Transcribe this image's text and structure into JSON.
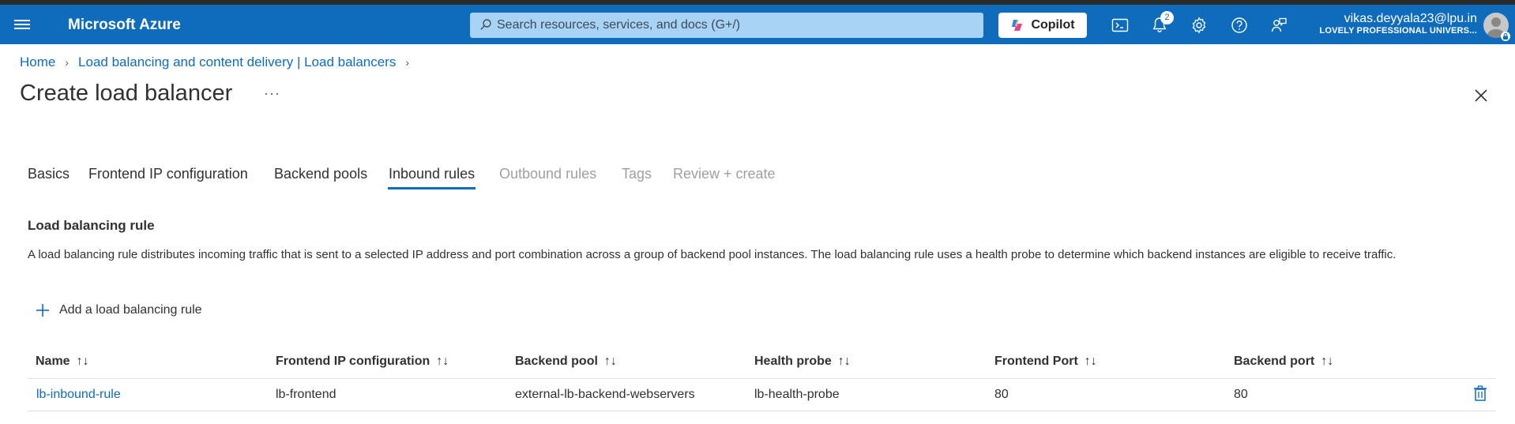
{
  "topbar": {
    "brand": "Microsoft Azure",
    "search_placeholder": "Search resources, services, and docs (G+/)",
    "copilot_label": "Copilot",
    "notifications_count": "2",
    "account_email": "vikas.deyyala23@lpu.in",
    "account_org": "LOVELY PROFESSIONAL UNIVERS..."
  },
  "breadcrumb": {
    "items": [
      "Home",
      "Load balancing and content delivery | Load balancers"
    ]
  },
  "page": {
    "title": "Create load balancer",
    "more": "···"
  },
  "tabs": [
    {
      "label": "Basics",
      "state": "enabled"
    },
    {
      "label": "Frontend IP configuration",
      "state": "enabled"
    },
    {
      "label": "Backend pools",
      "state": "enabled"
    },
    {
      "label": "Inbound rules",
      "state": "active"
    },
    {
      "label": "Outbound rules",
      "state": "disabled"
    },
    {
      "label": "Tags",
      "state": "disabled"
    },
    {
      "label": "Review + create",
      "state": "disabled"
    }
  ],
  "section": {
    "title": "Load balancing rule",
    "description": "A load balancing rule distributes incoming traffic that is sent to a selected IP address and port combination across a group of backend pool instances. The load balancing rule uses a health probe to determine which backend instances are eligible to receive traffic.",
    "add_label": "Add a load balancing rule"
  },
  "table": {
    "sort_glyph": "↑↓",
    "columns": [
      "Name",
      "Frontend IP configuration",
      "Backend pool",
      "Health probe",
      "Frontend Port",
      "Backend port"
    ],
    "rows": [
      {
        "name": "lb-inbound-rule",
        "frontend_ip": "lb-frontend",
        "backend_pool": "external-lb-backend-webservers",
        "health_probe": "lb-health-probe",
        "frontend_port": "80",
        "backend_port": "80"
      }
    ]
  },
  "colors": {
    "brand_blue": "#0f6cbd",
    "search_bg": "#a9d3f5",
    "disabled_text": "#a19f9d"
  },
  "icons": {
    "menu": "hamburger-icon",
    "search": "search-icon",
    "cloud_shell": "terminal-icon",
    "notifications": "bell-icon",
    "settings": "gear-icon",
    "help": "question-icon",
    "feedback": "feedback-icon",
    "close": "close-icon",
    "add": "plus-icon",
    "delete": "trash-icon"
  }
}
